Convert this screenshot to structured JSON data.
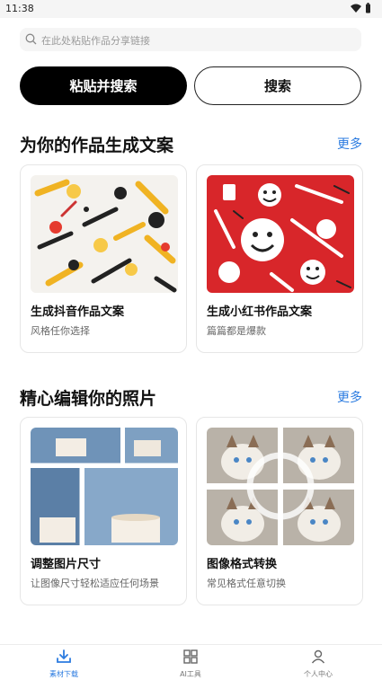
{
  "status": {
    "time": "11:38"
  },
  "search": {
    "placeholder": "在此处粘贴作品分享链接"
  },
  "buttons": {
    "paste_search": "粘贴并搜索",
    "search": "搜索"
  },
  "sections": [
    {
      "title": "为你的作品生成文案",
      "more": "更多",
      "cards": [
        {
          "title": "生成抖音作品文案",
          "subtitle": "风格任你选择"
        },
        {
          "title": "生成小红书作品文案",
          "subtitle": "篇篇都是爆款"
        }
      ]
    },
    {
      "title": "精心编辑你的照片",
      "more": "更多",
      "cards": [
        {
          "title": "调整图片尺寸",
          "subtitle": "让图像尺寸轻松适应任何场景"
        },
        {
          "title": "图像格式转换",
          "subtitle": "常见格式任意切换"
        }
      ]
    }
  ],
  "tabbar": {
    "tabs": [
      {
        "label": "素材下载",
        "icon": "download-icon",
        "active": true
      },
      {
        "label": "AI工具",
        "icon": "grid-icon",
        "active": false
      },
      {
        "label": "个人中心",
        "icon": "person-icon",
        "active": false
      }
    ]
  },
  "colors": {
    "accent": "#2b7be0",
    "primary_button": "#000000",
    "thumb_red": "#d8262a"
  }
}
